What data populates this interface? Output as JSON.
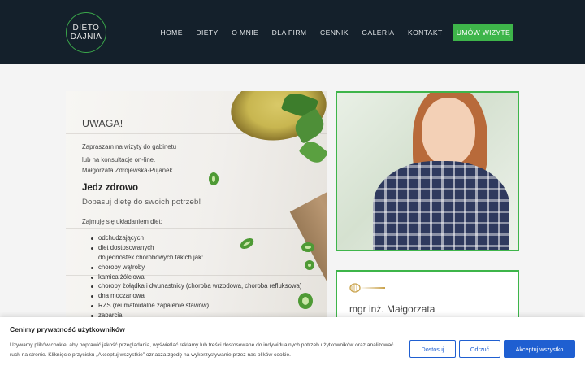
{
  "header": {
    "logo_line1": "DIETO",
    "logo_line2": "DAJNIA",
    "nav": [
      "HOME",
      "DIETY",
      "O MNIE",
      "DLA FIRM",
      "CENNIK",
      "GALERIA",
      "KONTAKT"
    ],
    "cta": "UMÓW WIZYTĘ"
  },
  "hero": {
    "heading": "UWAGA!",
    "intro": [
      "Zapraszam na wizyty do gabinetu",
      "lub na konsultacje on-line.",
      "Małgorzata Zdrojewska-Pujanek"
    ],
    "title": "Jedz zdrowo",
    "subtitle": "Dopasuj dietę do swoich potrzeb!",
    "lead": "Zajmuję się układaniem diet:",
    "items": [
      "odchudzających",
      "diet dostosowanych",
      "do jednostek chorobowych takich jak:",
      "choroby wątroby",
      "kamica żółciowa",
      "choroby żołądka i dwunastnicy (choroba wrzodowa, choroba refluksowa)",
      "dna moczanowa",
      "RZS (reumatoidalne zapalenie stawów)",
      "zaparcia"
    ]
  },
  "profile": {
    "name": "mgr inż. Małgorzata"
  },
  "cookie": {
    "title": "Cenimy prywatność użytkowników",
    "text": "Używamy plików cookie, aby poprawić jakość przeglądania, wyświetlać reklamy lub treści dostosowane do indywidualnych potrzeb użytkowników oraz analizować ruch na stronie. Kliknięcie przycisku „Akceptuj wszystkie” oznacza zgodę na wykorzystywanie przez nas plików cookie.",
    "btn_customize": "Dostosuj",
    "btn_reject": "Odrzuć",
    "btn_accept": "Akceptuj wszystko"
  },
  "colors": {
    "header_bg": "#14202b",
    "accent_green": "#3eb54a",
    "cookie_blue": "#1f5fd1"
  }
}
